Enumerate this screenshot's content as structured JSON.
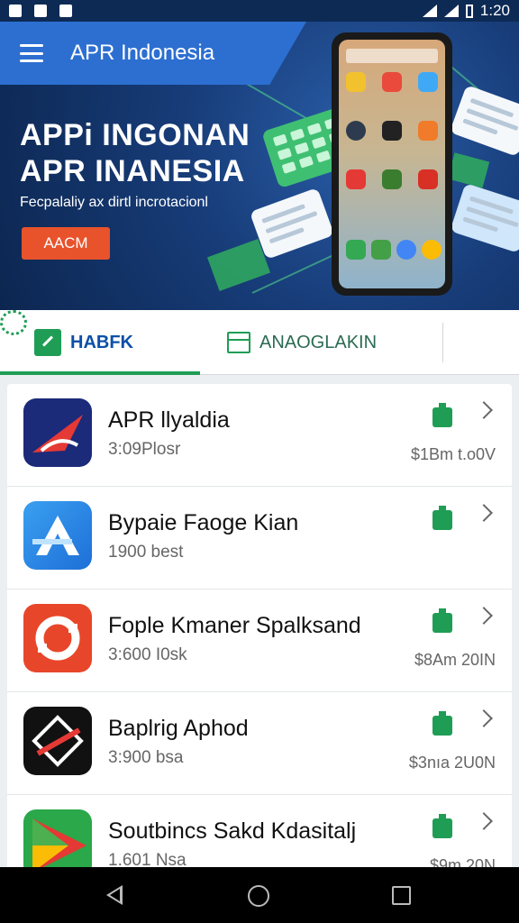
{
  "status_bar": {
    "time": "1:20"
  },
  "app_bar": {
    "title": "APR Indonesia"
  },
  "hero": {
    "headline_line1": "APPi INGONAN",
    "headline_line2": "APR INANESIA",
    "subtitle": "Fecpalaliy ax dirtl incrotacionl",
    "cta_label": "AACM"
  },
  "tabs": [
    {
      "label": "HABFK",
      "selected": true
    },
    {
      "label": "ANAOGLAKIN",
      "selected": false
    }
  ],
  "apps": [
    {
      "name": "APR llyaldia",
      "meta": "3:09Plosr",
      "size": "$1Bm t.o0V",
      "icon": "red-swoosh-icon"
    },
    {
      "name": "Bypaie Faoge Kian",
      "meta": "1900 best",
      "size": "",
      "icon": "blue-a-icon"
    },
    {
      "name": "Fople Kmaner Spalksand",
      "meta": "3:600 I0sk",
      "size": "$8Am 20IN",
      "icon": "orange-gear-icon"
    },
    {
      "name": "Baplrig Aphod",
      "meta": "3:900 bsa",
      "size": "$3nıa 2U0N",
      "icon": "black-diamond-icon"
    },
    {
      "name": "Soutbincs Sakd Kdasitalj",
      "meta": "1.601 Nsa",
      "size": "$9m 20N",
      "icon": "play-triangle-icon"
    }
  ],
  "colors": {
    "accent_green": "#1f9d55",
    "app_bar_blue": "#2d6fd1",
    "cta_orange": "#e8532c"
  }
}
